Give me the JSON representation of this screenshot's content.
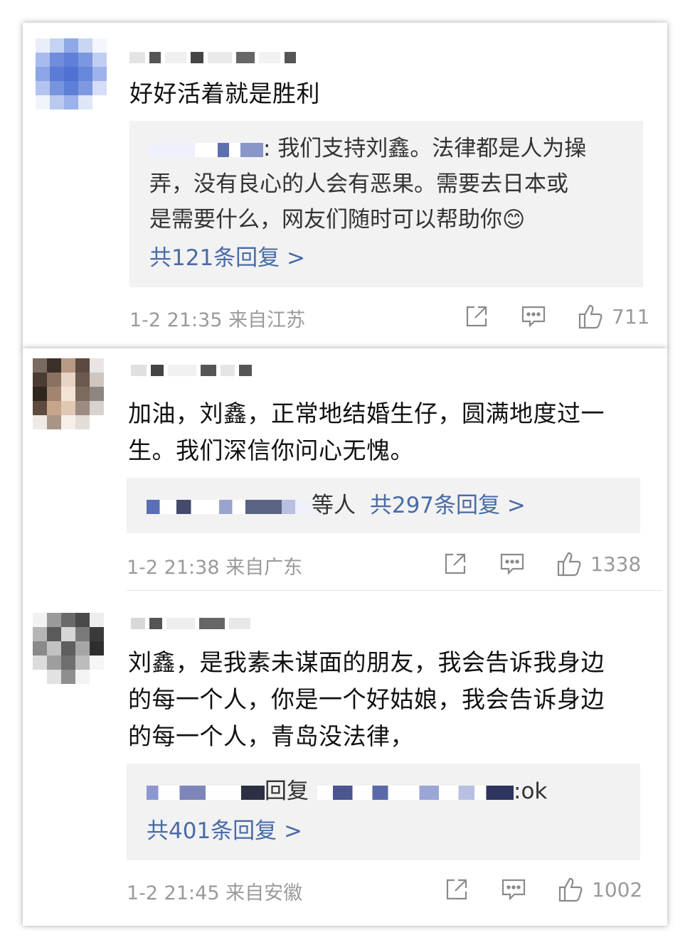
{
  "comments": [
    {
      "content": "好好活着就是胜利",
      "reply_preview": ": 我们支持刘鑫。法律都是人为操弄，没有良心的人会有恶果。需要去日本或是需要什么，网友们随时可以帮助你",
      "reply_line1": ": 我们支持刘鑫。法律都是人为操",
      "reply_line2": "弄，没有良心的人会有恶果。需要去日本或",
      "reply_line3": "是需要什么，网友们随时可以帮助你",
      "reply_emoji": "😊",
      "reply_count_label": "共121条回复 >",
      "time": "1-2 21:35",
      "source": "来自江苏",
      "likes": "711"
    },
    {
      "content_line1": "加油，刘鑫，正常地结婚生仔，圆满地度过一",
      "content_line2": "生。我们深信你问心无愧。",
      "reply_suffix": "等人",
      "reply_count_label": "共297条回复 >",
      "time": "1-2 21:38",
      "source": "来自广东",
      "likes": "1338"
    },
    {
      "content_line1": "刘鑫，是我素未谋面的朋友，我会告诉我身边",
      "content_line2": "的每一个人，你是一个好姑娘，我会告诉身边",
      "content_line3": "的每一个人，青岛没法律，",
      "reply_mid": "回复",
      "reply_end": ":ok",
      "reply_count_label": "共401条回复 >",
      "time": "1-2 21:45",
      "source": "来自安徽",
      "likes": "1002"
    }
  ],
  "icons": {
    "share": "share-icon",
    "comment": "comment-icon",
    "like": "thumbs-up-icon"
  },
  "colors": {
    "link": "#4a6ba6",
    "meta": "#9a9a9a",
    "reply_bg": "#f2f2f2"
  }
}
